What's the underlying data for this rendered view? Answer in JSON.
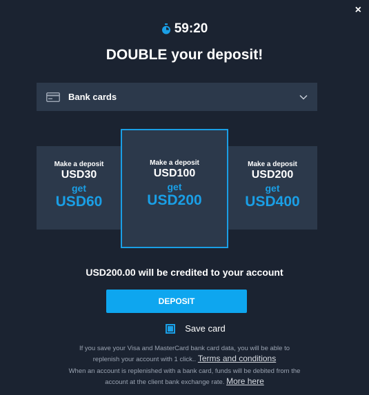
{
  "close_symbol": "×",
  "timer": {
    "time": "59:20",
    "icon": "stopwatch-icon",
    "color": "#1a9fe6"
  },
  "headline": "DOUBLE your deposit!",
  "payment_method": {
    "label": "Bank cards",
    "icon": "credit-card-icon"
  },
  "offers": [
    {
      "prefix": "Make a deposit",
      "deposit": "USD30",
      "get": "get",
      "bonus": "USD60",
      "selected": false
    },
    {
      "prefix": "Make a deposit",
      "deposit": "USD100",
      "get": "get",
      "bonus": "USD200",
      "selected": true
    },
    {
      "prefix": "Make a deposit",
      "deposit": "USD200",
      "get": "get",
      "bonus": "USD400",
      "selected": false
    }
  ],
  "credited_text": "USD200.00 will be credited to your account",
  "deposit_button": "DEPOSIT",
  "save_card": {
    "label": "Save card",
    "checked": true
  },
  "notes": {
    "save_line1": "If you save your Visa and MasterCard bank card data, you will be able to",
    "save_line2": "replenish your account with 1 click..",
    "terms_link": "Terms and conditions",
    "rate_line1": "When an account is replenished with a bank card, funds will be debited from the",
    "rate_line2": "account at the client bank exchange rate.",
    "more_link": "More here"
  },
  "colors": {
    "background": "#1b2331",
    "panel": "#2c394b",
    "accent": "#1a9fe6",
    "button": "#0ea6ef"
  }
}
